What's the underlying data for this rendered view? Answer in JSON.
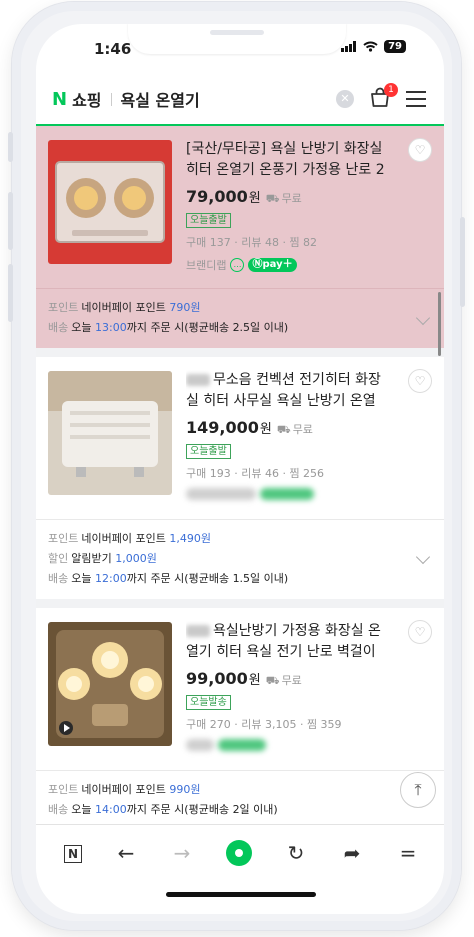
{
  "status": {
    "time": "1:46",
    "battery": "79"
  },
  "header": {
    "logo_n": "N",
    "logo_text": "쇼핑",
    "query": "욕실 온열기",
    "cart_badge": "1"
  },
  "products": [
    {
      "title": "[국산/무타공] 욕실 난방기 화장실 히터 온열기 온풍기 가정용 난로 2구 ...",
      "price": "79,000",
      "won": "원",
      "shipping": "무료",
      "badge": "오늘출발",
      "stats": "구매 137 · 리뷰 48 · 찜 82",
      "brand": "브랜디랩",
      "npay": "pay",
      "point_label": "포인트",
      "point_text": "네이버페이 포인트",
      "point_value": "790원",
      "delivery_label": "배송",
      "delivery_prefix": "오늘",
      "delivery_time": "13:00",
      "delivery_suffix": "까지 주문 시(평균배송 2.5일 이내)"
    },
    {
      "title": "무소음 컨벡션 전기히터 화장실 히터 사무실 욕실 난방기 온열기",
      "price": "149,000",
      "won": "원",
      "shipping": "무료",
      "badge": "오늘출발",
      "stats": "구매 193 · 리뷰 46 · 찜 256",
      "point_label": "포인트",
      "point_text": "네이버페이 포인트",
      "point_value": "1,490원",
      "discount_label": "할인",
      "discount_text": "알림받기",
      "discount_value": "1,000원",
      "delivery_label": "배송",
      "delivery_prefix": "오늘",
      "delivery_time": "12:00",
      "delivery_suffix": "까지 주문 시(평균배송 1.5일 이내)"
    },
    {
      "title": "욕실난방기 가정용 화장실 온열기 히터 욕실 전기 난로 벽걸이 난...",
      "price": "99,000",
      "won": "원",
      "shipping": "무료",
      "badge": "오늘발송",
      "stats": "구매 270 · 리뷰 3,105 · 찜 359",
      "point_label": "포인트",
      "point_text": "네이버페이 포인트",
      "point_value": "990원",
      "delivery_label": "배송",
      "delivery_prefix": "오늘",
      "delivery_time": "14:00",
      "delivery_suffix": "까지 주문 시(평균배송 2일 이내)"
    }
  ],
  "toolbar": {
    "n_label": "N"
  },
  "colors": {
    "accent": "#03c75a",
    "highlight": "#e8c7cc",
    "link": "#3b6ed6"
  }
}
